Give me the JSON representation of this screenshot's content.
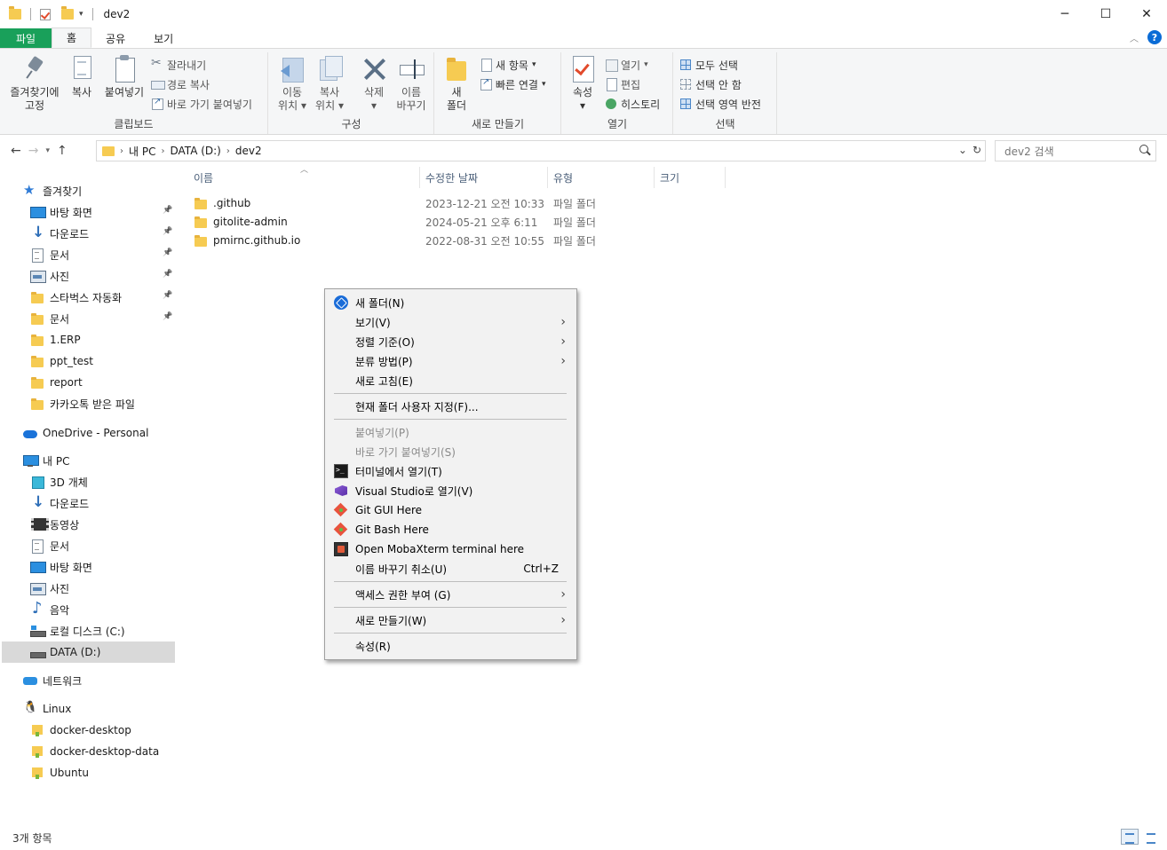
{
  "window": {
    "title": "dev2",
    "controls": {
      "minimize": "─",
      "maximize": "☐",
      "close": "✕"
    }
  },
  "ribbon_tabs": [
    {
      "label": "파일"
    },
    {
      "label": "홈"
    },
    {
      "label": "공유"
    },
    {
      "label": "보기"
    }
  ],
  "ribbon": {
    "clipboard": {
      "label": "클립보드",
      "pin": [
        "즐겨찾기에",
        "고정"
      ],
      "copy": "복사",
      "paste": "붙여넣기",
      "cut": "잘라내기",
      "copy_path": "경로 복사",
      "paste_shortcut": "바로 가기 붙여넣기"
    },
    "organize": {
      "label": "구성",
      "move_to": [
        "이동",
        "위치"
      ],
      "copy_to": [
        "복사",
        "위치"
      ],
      "delete": "삭제",
      "rename": [
        "이름",
        "바꾸기"
      ]
    },
    "new": {
      "label": "새로 만들기",
      "new_folder": [
        "새",
        "폴더"
      ],
      "new_item": "새 항목",
      "easy_access": "빠른 연결"
    },
    "open": {
      "label": "열기",
      "properties": "속성",
      "open": "열기",
      "edit": "편집",
      "history": "히스토리"
    },
    "select": {
      "label": "선택",
      "select_all": "모두 선택",
      "select_none": "선택 안 함",
      "invert": "선택 영역 반전"
    }
  },
  "address": {
    "crumbs": [
      "내 PC",
      "DATA (D:)",
      "dev2"
    ],
    "search_placeholder": "dev2 검색"
  },
  "sidebar": {
    "quick_access": "즐겨찾기",
    "quick_items": [
      {
        "label": "바탕 화면",
        "icon": "desktop-icon",
        "pinned": true
      },
      {
        "label": "다운로드",
        "icon": "download-icon",
        "pinned": true
      },
      {
        "label": "문서",
        "icon": "document-icon",
        "pinned": true
      },
      {
        "label": "사진",
        "icon": "picture-icon",
        "pinned": true
      },
      {
        "label": "스타벅스 자동화",
        "icon": "folder-icon",
        "pinned": true
      },
      {
        "label": "문서",
        "icon": "folder-icon",
        "pinned": true
      },
      {
        "label": "1.ERP",
        "icon": "folder-icon",
        "pinned": false
      },
      {
        "label": "ppt_test",
        "icon": "folder-icon",
        "pinned": false
      },
      {
        "label": "report",
        "icon": "folder-icon",
        "pinned": false
      },
      {
        "label": "카카오톡 받은 파일",
        "icon": "folder-icon",
        "pinned": false
      }
    ],
    "onedrive": "OneDrive - Personal",
    "this_pc": "내 PC",
    "pc_items": [
      {
        "label": "3D 개체",
        "icon": "cube-icon"
      },
      {
        "label": "다운로드",
        "icon": "download-icon"
      },
      {
        "label": "동영상",
        "icon": "video-icon"
      },
      {
        "label": "문서",
        "icon": "document-icon"
      },
      {
        "label": "바탕 화면",
        "icon": "desktop-icon"
      },
      {
        "label": "사진",
        "icon": "picture-icon"
      },
      {
        "label": "음악",
        "icon": "music-icon"
      },
      {
        "label": "로컬 디스크 (C:)",
        "icon": "drive-c-icon"
      },
      {
        "label": "DATA (D:)",
        "icon": "drive-icon"
      }
    ],
    "network": "네트워크",
    "linux": "Linux",
    "linux_items": [
      {
        "label": "docker-desktop"
      },
      {
        "label": "docker-desktop-data"
      },
      {
        "label": "Ubuntu"
      }
    ]
  },
  "file_list": {
    "columns": [
      "이름",
      "수정한 날짜",
      "유형",
      "크기"
    ],
    "rows": [
      {
        "name": ".github",
        "date": "2023-12-21 오전 10:33",
        "type": "파일 폴더"
      },
      {
        "name": "gitolite-admin",
        "date": "2024-05-21 오후 6:11",
        "type": "파일 폴더"
      },
      {
        "name": "pmirnc.github.io",
        "date": "2022-08-31 오전 10:55",
        "type": "파일 폴더"
      }
    ]
  },
  "context_menu": {
    "items": [
      {
        "label": "새 폴더(N)",
        "icon": "new-folder-icon"
      },
      {
        "label": "보기(V)",
        "submenu": true
      },
      {
        "label": "정렬 기준(O)",
        "submenu": true
      },
      {
        "label": "분류 방법(P)",
        "submenu": true
      },
      {
        "label": "새로 고침(E)"
      },
      {
        "label": "현재 폴더 사용자 지정(F)..."
      },
      {
        "label": "붙여넣기(P)",
        "disabled": true
      },
      {
        "label": "바로 가기 붙여넣기(S)",
        "disabled": true
      },
      {
        "label": "터미널에서 열기(T)",
        "icon": "terminal-icon"
      },
      {
        "label": "Visual Studio로 열기(V)",
        "icon": "visual-studio-icon"
      },
      {
        "label": "Git GUI Here",
        "icon": "git-icon"
      },
      {
        "label": "Git Bash Here",
        "icon": "git-icon"
      },
      {
        "label": "Open MobaXterm terminal here",
        "icon": "mobaxterm-icon"
      },
      {
        "label": "이름 바꾸기 취소(U)",
        "shortcut": "Ctrl+Z"
      },
      {
        "label": "액세스 권한 부여 (G)",
        "submenu": true
      },
      {
        "label": "새로 만들기(W)",
        "submenu": true
      },
      {
        "label": "속성(R)"
      }
    ]
  },
  "status": {
    "count": "3개 항목"
  }
}
